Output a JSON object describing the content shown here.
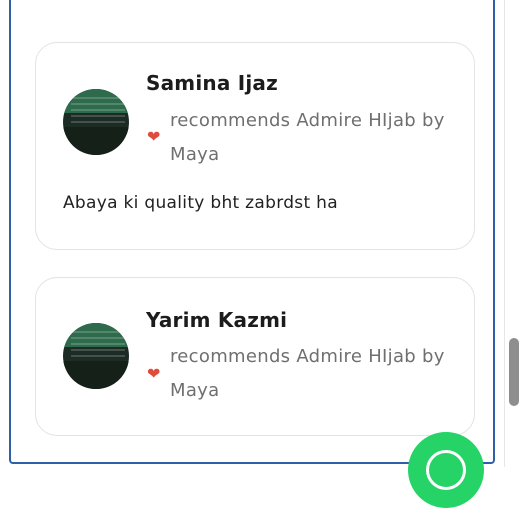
{
  "reviews": [
    {
      "name": "Samina Ijaz",
      "recommends": "recommends Admire HIjab by Maya",
      "text": "Abaya ki quality bht zabrdst ha"
    },
    {
      "name": "Yarim Kazmi",
      "recommends": "recommends Admire HIjab by Maya",
      "text": ""
    }
  ],
  "icons": {
    "recommend": "heart-icon",
    "chat": "whatsapp-icon"
  },
  "colors": {
    "heart": "#e04b3c",
    "whatsapp": "#25d366",
    "frame_border": "#2f5fa8"
  }
}
